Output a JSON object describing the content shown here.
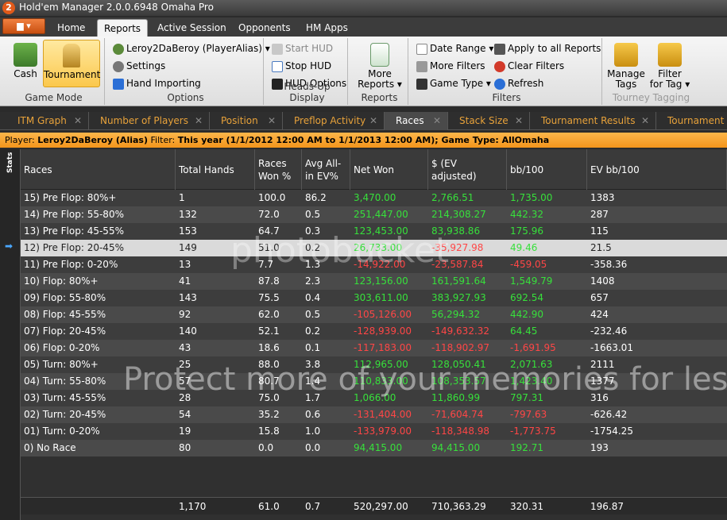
{
  "window": {
    "title": "Hold'em Manager 2.0.0.6948 Omaha Pro",
    "app_icon": "2"
  },
  "ribbon_tabs": [
    "Home",
    "Reports",
    "Active Session",
    "Opponents",
    "HM Apps"
  ],
  "ribbon": {
    "game_mode": {
      "label": "Game Mode",
      "cash": "Cash",
      "tournament": "Tournament"
    },
    "options": {
      "label": "Options",
      "player": "Leroy2DaBeroy (PlayerAlias)",
      "settings": "Settings",
      "hand_importing": "Hand Importing"
    },
    "hud": {
      "label": "Heads-Up Display",
      "start": "Start HUD",
      "stop": "Stop HUD",
      "options": "HUD Options"
    },
    "reports": {
      "label": "Reports",
      "more_line1": "More",
      "more_line2": "Reports"
    },
    "filters": {
      "label": "Filters",
      "date_range": "Date Range",
      "more_filters": "More Filters",
      "game_type": "Game Type",
      "apply_all": "Apply to all Reports",
      "clear": "Clear Filters",
      "refresh": "Refresh"
    },
    "tagging": {
      "label": "Tourney Tagging",
      "manage_line1": "Manage",
      "manage_line2": "Tags",
      "filter_line1": "Filter",
      "filter_line2": "for Tag"
    }
  },
  "doc_tabs": [
    "ITM Graph",
    "Number of Players",
    "Position",
    "Preflop Activity",
    "Races",
    "Stack Size",
    "Tournament Results",
    "Tournament R"
  ],
  "filterbar": {
    "player_label": "Player:",
    "player_value": "Leroy2DaBeroy (Alias)",
    "filter_label": "Filter:",
    "filter_value": "This year (1/1/2012 12:00 AM to 1/1/2013 12:00 AM); Game Type: AllOmaha"
  },
  "stats_label": "Stats",
  "table": {
    "headers": [
      "Races",
      "Total Hands",
      "Races Won %",
      "Avg All-in EV%",
      "Net Won",
      "$ (EV adjusted)",
      "bb/100",
      "EV bb/100"
    ],
    "rows": [
      [
        "15) Pre Flop: 80%+",
        "1",
        "100.0",
        "86.2",
        "3,470.00",
        "2,766.51",
        "1,735.00",
        "1383"
      ],
      [
        "14) Pre Flop: 55-80%",
        "132",
        "72.0",
        "0.5",
        "251,447.00",
        "214,308.27",
        "442.32",
        "287"
      ],
      [
        "13) Pre Flop: 45-55%",
        "153",
        "64.7",
        "0.3",
        "123,453.00",
        "83,938.86",
        "175.96",
        "115"
      ],
      [
        "12) Pre Flop: 20-45%",
        "149",
        "51.0",
        "0.2",
        "26,733.00",
        "-35,927.98",
        "49.46",
        "21.5"
      ],
      [
        "11) Pre Flop: 0-20%",
        "13",
        "7.7",
        "1.3",
        "-14,922.00",
        "-23,587.84",
        "-459.05",
        "-358.36"
      ],
      [
        "10) Flop: 80%+",
        "41",
        "87.8",
        "2.3",
        "123,156.00",
        "161,591.64",
        "1,549.79",
        "1408"
      ],
      [
        "09) Flop: 55-80%",
        "143",
        "75.5",
        "0.4",
        "303,611.00",
        "383,927.93",
        "692.54",
        "657"
      ],
      [
        "08) Flop: 45-55%",
        "92",
        "62.0",
        "0.5",
        "-105,126.00",
        "56,294.32",
        "442.90",
        "424"
      ],
      [
        "07) Flop: 20-45%",
        "140",
        "52.1",
        "0.2",
        "-128,939.00",
        "-149,632.32",
        "64.45",
        "-232.46"
      ],
      [
        "06) Flop: 0-20%",
        "43",
        "18.6",
        "0.1",
        "-117,183.00",
        "-118,902.97",
        "-1,691.95",
        "-1663.01"
      ],
      [
        "05) Turn: 80%+",
        "25",
        "88.0",
        "3.8",
        "112,965.00",
        "128,050.41",
        "2,071.63",
        "2111"
      ],
      [
        "04) Turn: 55-80%",
        "57",
        "80.7",
        "1.4",
        "110,833.00",
        "108,353.57",
        "1,423.40",
        "1377"
      ],
      [
        "03) Turn: 45-55%",
        "28",
        "75.0",
        "1.7",
        "1,066.00",
        "11,860.99",
        "797.31",
        "316"
      ],
      [
        "02) Turn: 20-45%",
        "54",
        "35.2",
        "0.6",
        "-131,404.00",
        "-71,604.74",
        "-797.63",
        "-626.42"
      ],
      [
        "01) Turn: 0-20%",
        "19",
        "15.8",
        "1.0",
        "-133,979.00",
        "-118,348.98",
        "-1,773.75",
        "-1754.25"
      ],
      [
        "0) No Race",
        "80",
        "0.0",
        "0.0",
        "94,415.00",
        "94,415.00",
        "192.71",
        "193"
      ]
    ],
    "totals": [
      "",
      "1,170",
      "61.0",
      "0.7",
      "520,297.00",
      "710,363.29",
      "320.31",
      "196.87"
    ]
  },
  "watermark": {
    "logo": "photobucket",
    "text": "Protect more of your memories for less!"
  },
  "colors": {
    "positive": "#37e03b",
    "negative": "#ff4646",
    "filterbar": "#f5a227",
    "tab_text": "#e8a23a"
  }
}
